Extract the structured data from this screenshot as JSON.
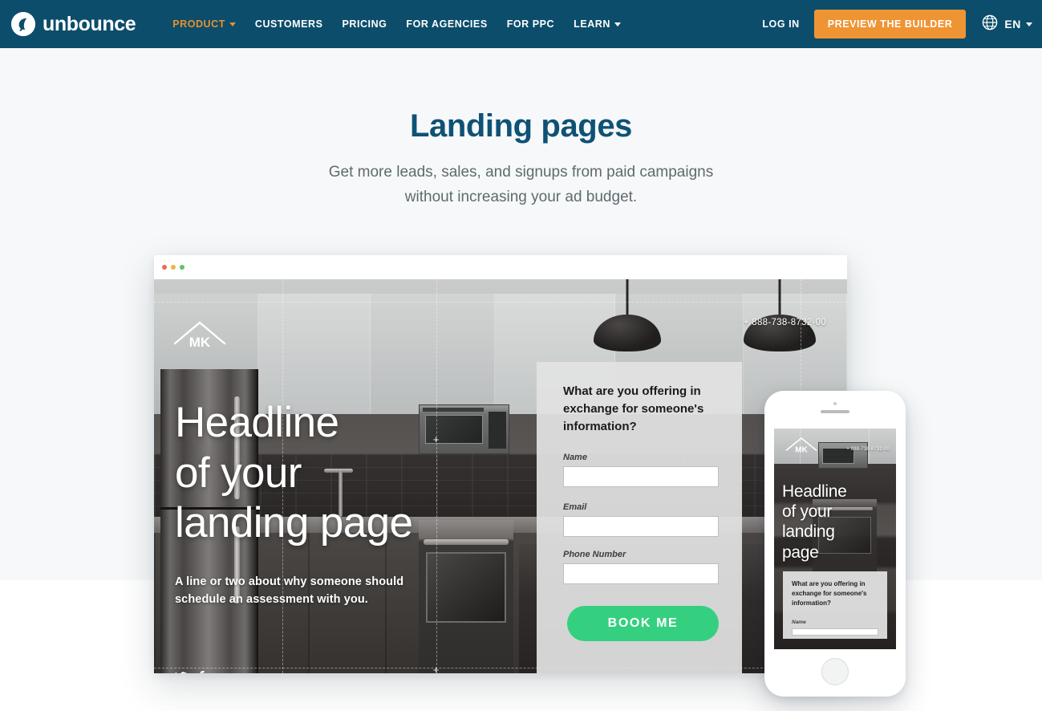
{
  "navbar": {
    "logo_text": "unbounce",
    "logo_icon": "unbounce-leaf-icon",
    "links": [
      {
        "label": "PRODUCT",
        "has_caret": true,
        "active": true
      },
      {
        "label": "CUSTOMERS",
        "has_caret": false,
        "active": false
      },
      {
        "label": "PRICING",
        "has_caret": false,
        "active": false
      },
      {
        "label": "FOR AGENCIES",
        "has_caret": false,
        "active": false
      },
      {
        "label": "FOR PPC",
        "has_caret": false,
        "active": false
      },
      {
        "label": "LEARN",
        "has_caret": true,
        "active": false
      }
    ],
    "login_label": "LOG IN",
    "cta_label": "PREVIEW THE BUILDER",
    "language_label": "EN",
    "language_icon": "globe-icon",
    "colors": {
      "background": "#0c4d6b",
      "cta_background": "#ef9433",
      "active_link": "#e8912d",
      "link": "#ffffff"
    }
  },
  "hero": {
    "title": "Landing pages",
    "subtitle_line1": "Get more leads, sales, and signups from paid campaigns",
    "subtitle_line2": "without increasing your ad budget.",
    "title_color": "#0e5275",
    "subtitle_color": "#5f6a6e",
    "background_color": "#f6f8f9"
  },
  "browser_mockup": {
    "traffic_lights": [
      "#e96a5f",
      "#e8b84a",
      "#5dc45d"
    ],
    "landing_page": {
      "brand_logo": "MK",
      "phone_number": "+ 888-738-8732-00",
      "headline_line1": "Headline",
      "headline_line2": "of your",
      "headline_line3": "landing page",
      "subcopy_line1": "A line or two about why someone should",
      "subcopy_line2": "schedule an assessment with you.",
      "social_icons": [
        "twitter-icon",
        "facebook-icon"
      ],
      "form": {
        "question": "What are you offering in exchange for someone's information?",
        "fields": [
          {
            "label": "Name",
            "value": ""
          },
          {
            "label": "Email",
            "value": ""
          },
          {
            "label": "Phone Number",
            "value": ""
          }
        ],
        "submit_label": "BOOK ME",
        "submit_color": "#35d07f"
      }
    }
  },
  "phone_mockup": {
    "landing_page": {
      "brand_logo": "MK",
      "phone_number": "+ 888-738-8732-00",
      "headline_line1": "Headline",
      "headline_line2": "of your",
      "headline_line3": "landing",
      "headline_line4": "page",
      "form": {
        "question": "What are you offering in exchange for someone's information?",
        "field_label": "Name"
      }
    }
  }
}
